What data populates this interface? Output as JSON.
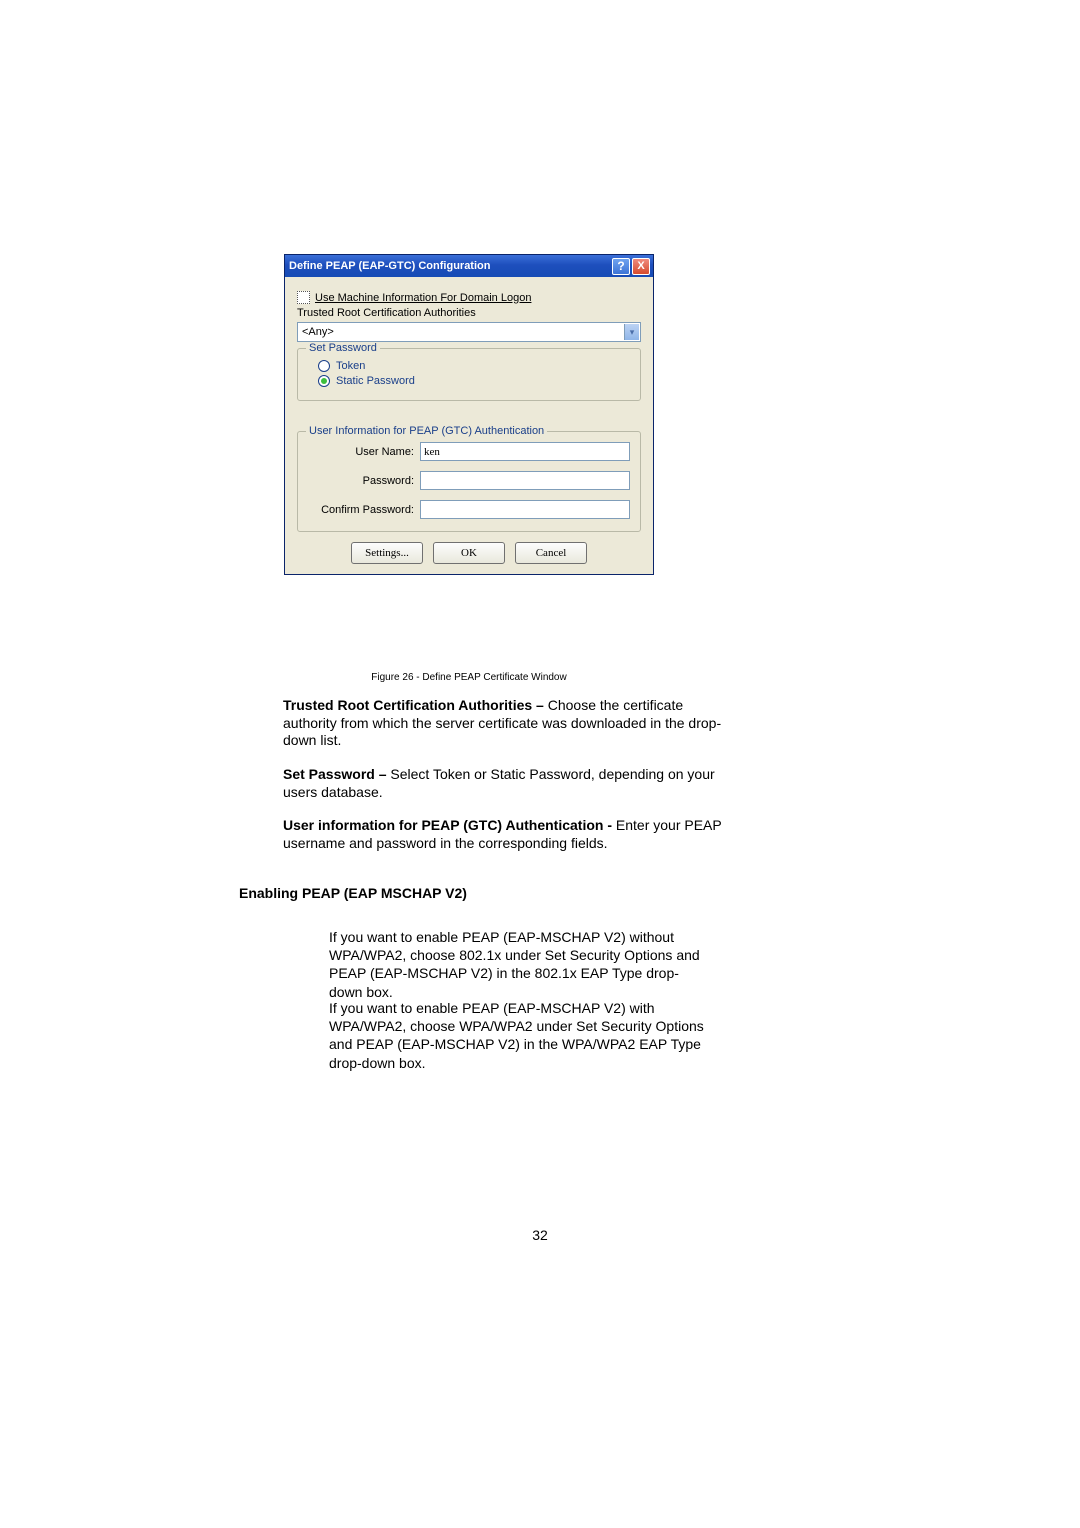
{
  "dialog": {
    "title": "Define PEAP (EAP-GTC) Configuration",
    "help_tooltip": "?",
    "close_tooltip": "X",
    "checkbox_label": "Use Machine Information For Domain Logon",
    "trusted_root_label": "Trusted Root Certification Authorities",
    "trusted_root_value": "<Any>",
    "set_password_legend": "Set Password",
    "radio_token": "Token",
    "radio_static": "Static Password",
    "user_info_legend": "User Information for PEAP (GTC) Authentication",
    "username_label": "User Name:",
    "username_value": "ken",
    "password_label": "Password:",
    "password_value": "",
    "confirm_label": "Confirm Password:",
    "confirm_value": "",
    "settings_btn": "Settings...",
    "ok_btn": "OK",
    "cancel_btn": "Cancel"
  },
  "caption": "Figure 26 - Define PEAP Certificate Window",
  "para1_bold": "Trusted Root Certification Authorities – ",
  "para1_rest": "Choose the certificate authority from which the server certificate was downloaded in the drop-down list.",
  "para2_bold": "Set Password – ",
  "para2_rest": "Select Token or Static Password, depending on your users database.",
  "para3_bold": "User information for PEAP (GTC) Authentication - ",
  "para3_rest": "Enter your PEAP username and password in the corresponding fields.",
  "section_heading": "Enabling PEAP (EAP MSCHAP V2)",
  "indent1": "If you want to enable PEAP (EAP-MSCHAP V2) without WPA/WPA2, choose 802.1x under Set Security Options and PEAP (EAP-MSCHAP V2) in the 802.1x EAP Type drop-down box.",
  "indent2": "If you want to enable PEAP (EAP-MSCHAP V2) with WPA/WPA2, choose WPA/WPA2 under Set Security Options and PEAP (EAP-MSCHAP V2) in the WPA/WPA2 EAP Type drop-down box.",
  "page_number": "32"
}
